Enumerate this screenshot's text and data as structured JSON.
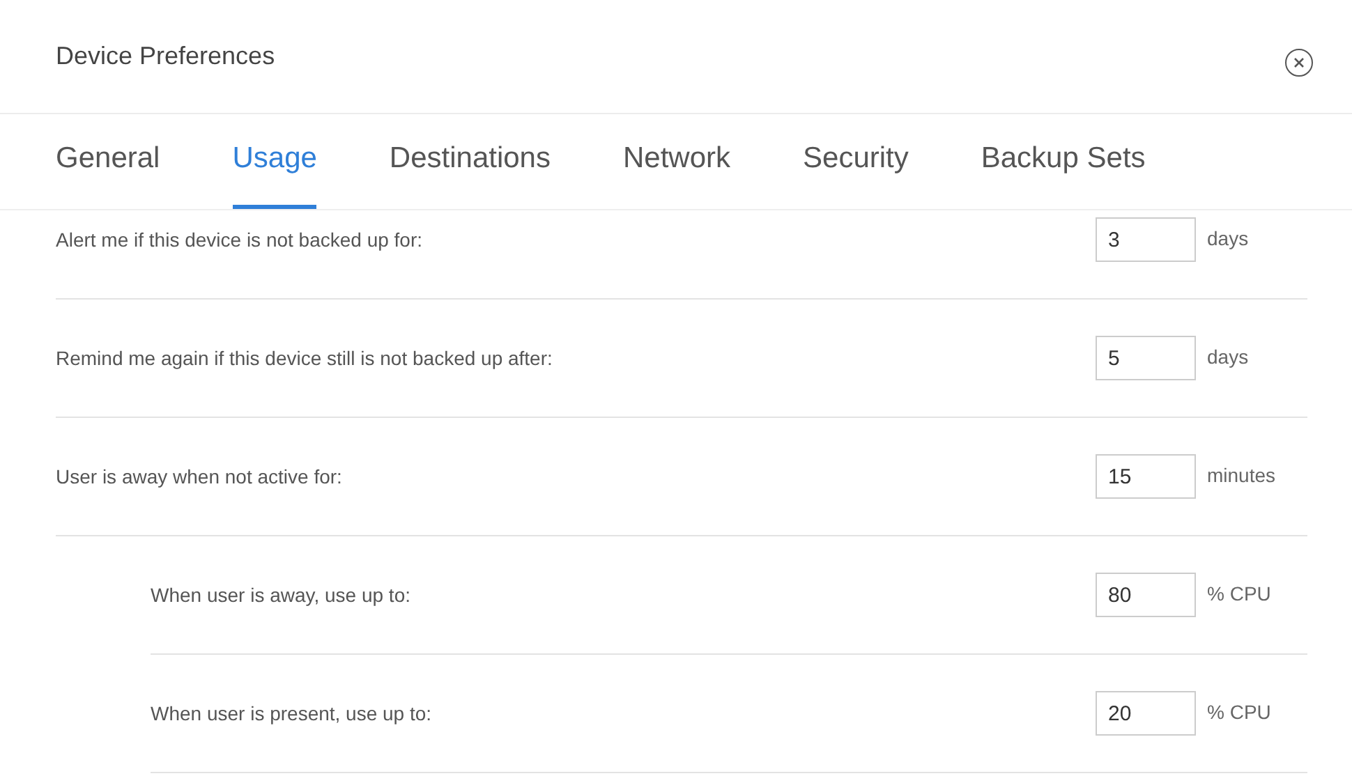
{
  "window": {
    "title": "Device Preferences"
  },
  "tabs": [
    {
      "label": "General",
      "selected": false
    },
    {
      "label": "Usage",
      "selected": true
    },
    {
      "label": "Destinations",
      "selected": false
    },
    {
      "label": "Network",
      "selected": false
    },
    {
      "label": "Security",
      "selected": false
    },
    {
      "label": "Backup Sets",
      "selected": false
    }
  ],
  "settings": [
    {
      "label": "Alert me if this device is not backed up for:",
      "value": "3",
      "unit": "days"
    },
    {
      "label": "Remind me again if this device still is not backed up after:",
      "value": "5",
      "unit": "days"
    },
    {
      "label": "User is away when not active for:",
      "value": "15",
      "unit": "minutes",
      "children": [
        {
          "label": "When user is away, use up to:",
          "value": "80",
          "unit": "% CPU"
        },
        {
          "label": "When user is present, use up to:",
          "value": "20",
          "unit": "% CPU"
        }
      ]
    }
  ]
}
